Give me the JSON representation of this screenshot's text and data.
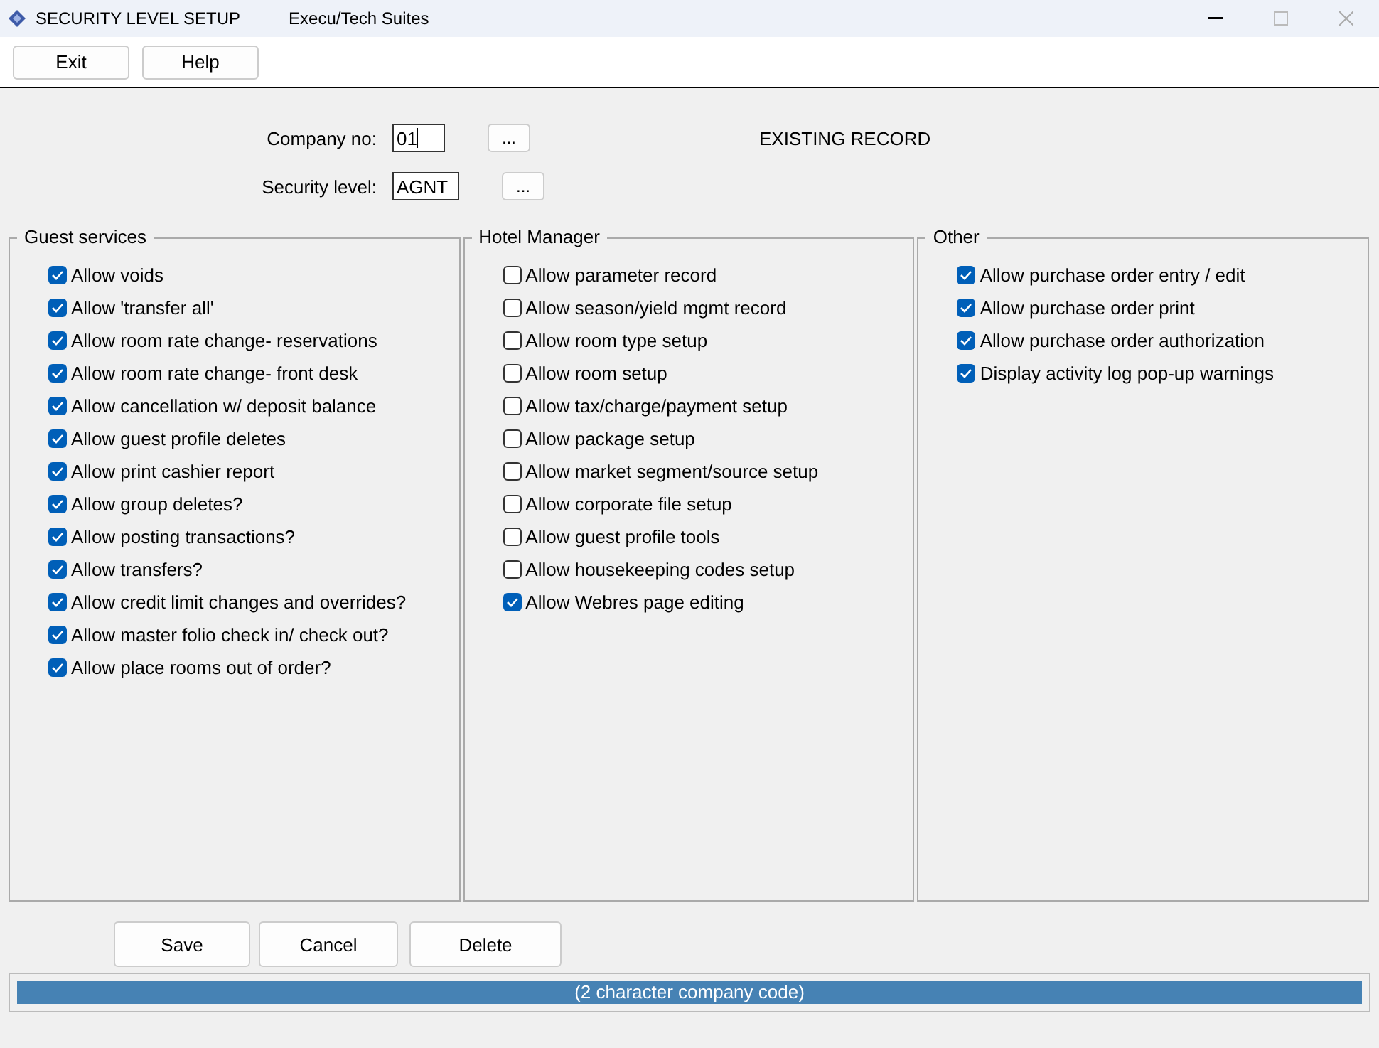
{
  "window": {
    "title": "SECURITY LEVEL SETUP",
    "app_name": "Execu/Tech Suites"
  },
  "toolbar": [
    "Exit",
    "Help"
  ],
  "fields": [
    {
      "label": "Company no:",
      "value": "01",
      "lookup": "...",
      "focused": true
    },
    {
      "label": "Security level:",
      "value": "AGNT",
      "lookup": "...",
      "focused": false
    }
  ],
  "record_status": "EXISTING RECORD",
  "groups": [
    {
      "title": "Guest services",
      "items": [
        {
          "label": "Allow voids",
          "checked": true
        },
        {
          "label": "Allow 'transfer all'",
          "checked": true
        },
        {
          "label": "Allow room rate change- reservations",
          "checked": true
        },
        {
          "label": "Allow room rate change- front desk",
          "checked": true
        },
        {
          "label": "Allow cancellation w/ deposit balance",
          "checked": true
        },
        {
          "label": "Allow guest profile deletes",
          "checked": true
        },
        {
          "label": "Allow print cashier report",
          "checked": true
        },
        {
          "label": "Allow group deletes?",
          "checked": true
        },
        {
          "label": "Allow posting transactions?",
          "checked": true
        },
        {
          "label": "Allow transfers?",
          "checked": true
        },
        {
          "label": "Allow credit limit changes and overrides?",
          "checked": true
        },
        {
          "label": "Allow master folio check in/ check out?",
          "checked": true
        },
        {
          "label": "Allow place rooms out of order?",
          "checked": true
        }
      ]
    },
    {
      "title": "Hotel Manager",
      "items": [
        {
          "label": "Allow parameter record",
          "checked": false
        },
        {
          "label": "Allow season/yield mgmt record",
          "checked": false
        },
        {
          "label": "Allow room type setup",
          "checked": false
        },
        {
          "label": "Allow room setup",
          "checked": false
        },
        {
          "label": "Allow tax/charge/payment setup",
          "checked": false
        },
        {
          "label": "Allow package setup",
          "checked": false
        },
        {
          "label": "Allow market segment/source setup",
          "checked": false
        },
        {
          "label": "Allow corporate file setup",
          "checked": false
        },
        {
          "label": "Allow guest profile tools",
          "checked": false
        },
        {
          "label": "Allow housekeeping codes setup",
          "checked": false
        },
        {
          "label": "Allow Webres page editing",
          "checked": true
        }
      ]
    },
    {
      "title": "Other",
      "items": [
        {
          "label": "Allow purchase order entry / edit",
          "checked": true
        },
        {
          "label": "Allow purchase order print",
          "checked": true
        },
        {
          "label": "Allow purchase order authorization",
          "checked": true
        },
        {
          "label": "Display activity log pop-up warnings",
          "checked": true
        }
      ]
    }
  ],
  "actions": [
    "Save",
    "Cancel",
    "Delete"
  ],
  "status_bar": "(2 character company code)"
}
